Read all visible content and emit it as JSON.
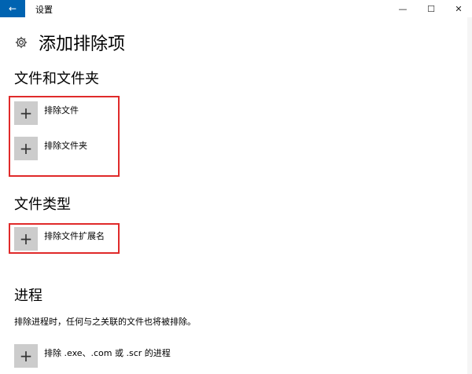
{
  "window": {
    "back_glyph": "←",
    "title": "设置",
    "min_glyph": "—",
    "max_glyph": "☐",
    "close_glyph": "✕"
  },
  "header": {
    "icon": "gear-icon",
    "title": "添加排除项"
  },
  "sections": {
    "files_folders": {
      "title": "文件和文件夹",
      "items": [
        {
          "label": "排除文件"
        },
        {
          "label": "排除文件夹"
        }
      ]
    },
    "file_types": {
      "title": "文件类型",
      "items": [
        {
          "label": "排除文件扩展名"
        }
      ]
    },
    "processes": {
      "title": "进程",
      "description": "排除进程时，任何与之关联的文件也将被排除。",
      "items": [
        {
          "label": "排除 .exe、.com 或 .scr 的进程"
        }
      ]
    }
  },
  "plus_glyph": "+",
  "colors": {
    "accent": "#0063b1",
    "highlight": "#e02a2a",
    "button_bg": "#cccccc"
  }
}
